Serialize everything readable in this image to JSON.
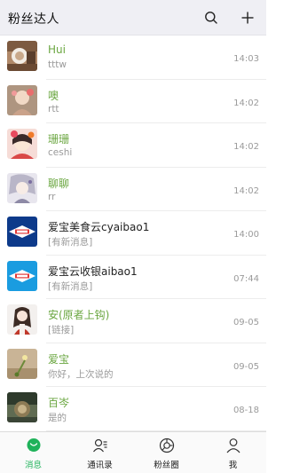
{
  "header": {
    "title": "粉丝达人"
  },
  "conversations": [
    {
      "name": "Hui",
      "message": "tttw",
      "time": "14:03"
    },
    {
      "name": "噢",
      "message": "rtt",
      "time": "14:02"
    },
    {
      "name": "珊珊",
      "message": "ceshi",
      "time": "14:02"
    },
    {
      "name": "聊聊",
      "message": "rr",
      "time": "14:02"
    },
    {
      "name": "爱宝美食云cyaibao1",
      "message": "[有新消息]",
      "time": "14:00"
    },
    {
      "name": "爱宝云收银aibao1",
      "message": "[有新消息]",
      "time": "07:44"
    },
    {
      "name": "安(原者上钩)",
      "message": "[链接]",
      "time": "09-05"
    },
    {
      "name": "爱宝",
      "message": "你好，上次说的",
      "time": "09-05"
    },
    {
      "name": "百岑",
      "message": "是的",
      "time": "08-18"
    }
  ],
  "tabs": [
    {
      "label": "消息",
      "icon": "message-icon"
    },
    {
      "label": "通讯录",
      "icon": "contacts-icon"
    },
    {
      "label": "粉丝圈",
      "icon": "moments-icon"
    },
    {
      "label": "我",
      "icon": "profile-icon"
    }
  ],
  "colors": {
    "accent": "#1fb25a",
    "name_green": "#6aa640",
    "header_bg": "#efeff4"
  }
}
